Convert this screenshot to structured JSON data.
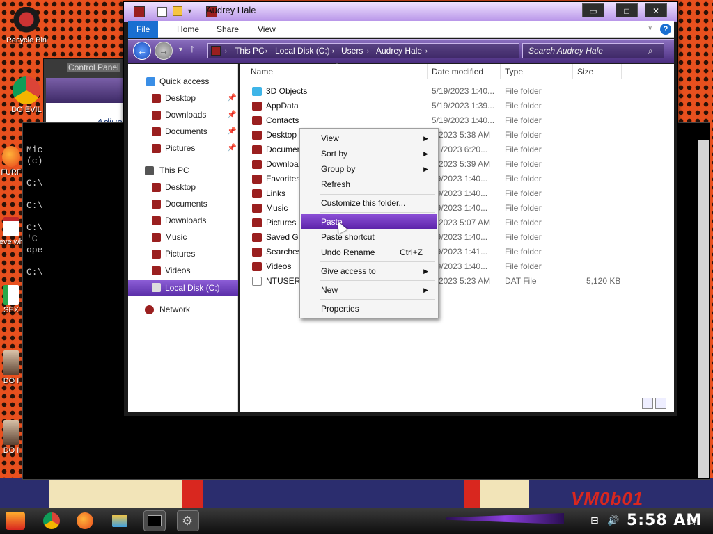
{
  "desktop": {
    "icons": [
      {
        "label": "Recycle Bin"
      },
      {
        "label": "DO EVIL"
      },
      {
        "label": "FURF"
      },
      {
        "label": "neve why"
      },
      {
        "label": "SEX"
      },
      {
        "label": "DO I"
      },
      {
        "label": "DO I"
      }
    ],
    "watermark": "VM0b01"
  },
  "control_panel": {
    "title": "Control Panel",
    "heading_partial": "Adjus"
  },
  "cmd": {
    "lines": [
      "Mic",
      "(c)",
      "C:\\",
      "C:\\",
      "C:\\",
      "'C",
      "ope",
      "C:\\"
    ]
  },
  "explorer": {
    "title": "Audrey Hale",
    "window_buttons": {
      "minimize": "▭",
      "maximize": "□",
      "close": "✕"
    },
    "ribbon_tabs": [
      "File",
      "Home",
      "Share",
      "View"
    ],
    "help": "?",
    "address": [
      "This PC",
      "Local Disk (C:)",
      "Users",
      "Audrey Hale"
    ],
    "search_placeholder": "Search Audrey Hale",
    "nav": {
      "quick_access": "Quick access",
      "quick_items": [
        "Desktop",
        "Downloads",
        "Documents",
        "Pictures"
      ],
      "this_pc": "This PC",
      "pc_items": [
        "Desktop",
        "Documents",
        "Downloads",
        "Music",
        "Pictures",
        "Videos",
        "Local Disk (C:)"
      ],
      "network": "Network"
    },
    "columns": [
      "Name",
      "Date modified",
      "Type",
      "Size"
    ],
    "files": [
      {
        "name": "3D Objects",
        "date": "5/19/2023 1:40...",
        "type": "File folder",
        "size": ""
      },
      {
        "name": "AppData",
        "date": "5/19/2023 1:39...",
        "type": "File folder",
        "size": ""
      },
      {
        "name": "Contacts",
        "date": "5/19/2023 1:40...",
        "type": "File folder",
        "size": ""
      },
      {
        "name": "Desktop",
        "date": "7/2023 5:38 AM",
        "type": "File folder",
        "size": ""
      },
      {
        "name": "Document",
        "date": "21/2023 6:20...",
        "type": "File folder",
        "size": ""
      },
      {
        "name": "Download",
        "date": "7/2023 5:39 AM",
        "type": "File folder",
        "size": ""
      },
      {
        "name": "Favorites",
        "date": "19/2023 1:40...",
        "type": "File folder",
        "size": ""
      },
      {
        "name": "Links",
        "date": "19/2023 1:40...",
        "type": "File folder",
        "size": ""
      },
      {
        "name": "Music",
        "date": "19/2023 1:40...",
        "type": "File folder",
        "size": ""
      },
      {
        "name": "Pictures",
        "date": "7/2023 5:07 AM",
        "type": "File folder",
        "size": ""
      },
      {
        "name": "Saved Ga",
        "date": "19/2023 1:40...",
        "type": "File folder",
        "size": ""
      },
      {
        "name": "Searches",
        "date": "19/2023 1:41...",
        "type": "File folder",
        "size": ""
      },
      {
        "name": "Videos",
        "date": "19/2023 1:40...",
        "type": "File folder",
        "size": ""
      },
      {
        "name": "NTUSER.D",
        "date": "7/2023 5:23 AM",
        "type": "DAT File",
        "size": "5,120 KB"
      }
    ]
  },
  "context_menu": {
    "items": [
      {
        "label": "View",
        "arrow": "▶"
      },
      {
        "label": "Sort by",
        "arrow": "▶"
      },
      {
        "label": "Group by",
        "arrow": "▶"
      },
      {
        "label": "Refresh"
      },
      {
        "label": "Customize this folder..."
      },
      {
        "label": "Paste"
      },
      {
        "label": "Paste shortcut"
      },
      {
        "label": "Undo Rename",
        "shortcut": "Ctrl+Z"
      },
      {
        "label": "Give access to",
        "arrow": "▶"
      },
      {
        "label": "New",
        "arrow": "▶"
      },
      {
        "label": "Properties"
      }
    ],
    "highlighted": "Paste"
  },
  "taskbar": {
    "clock": "5:58 AM"
  },
  "colors": {
    "accent_purple": "#6a2fc0",
    "wallpaper_orange": "#e8501e",
    "ribbon_file": "#1a6fd1"
  }
}
